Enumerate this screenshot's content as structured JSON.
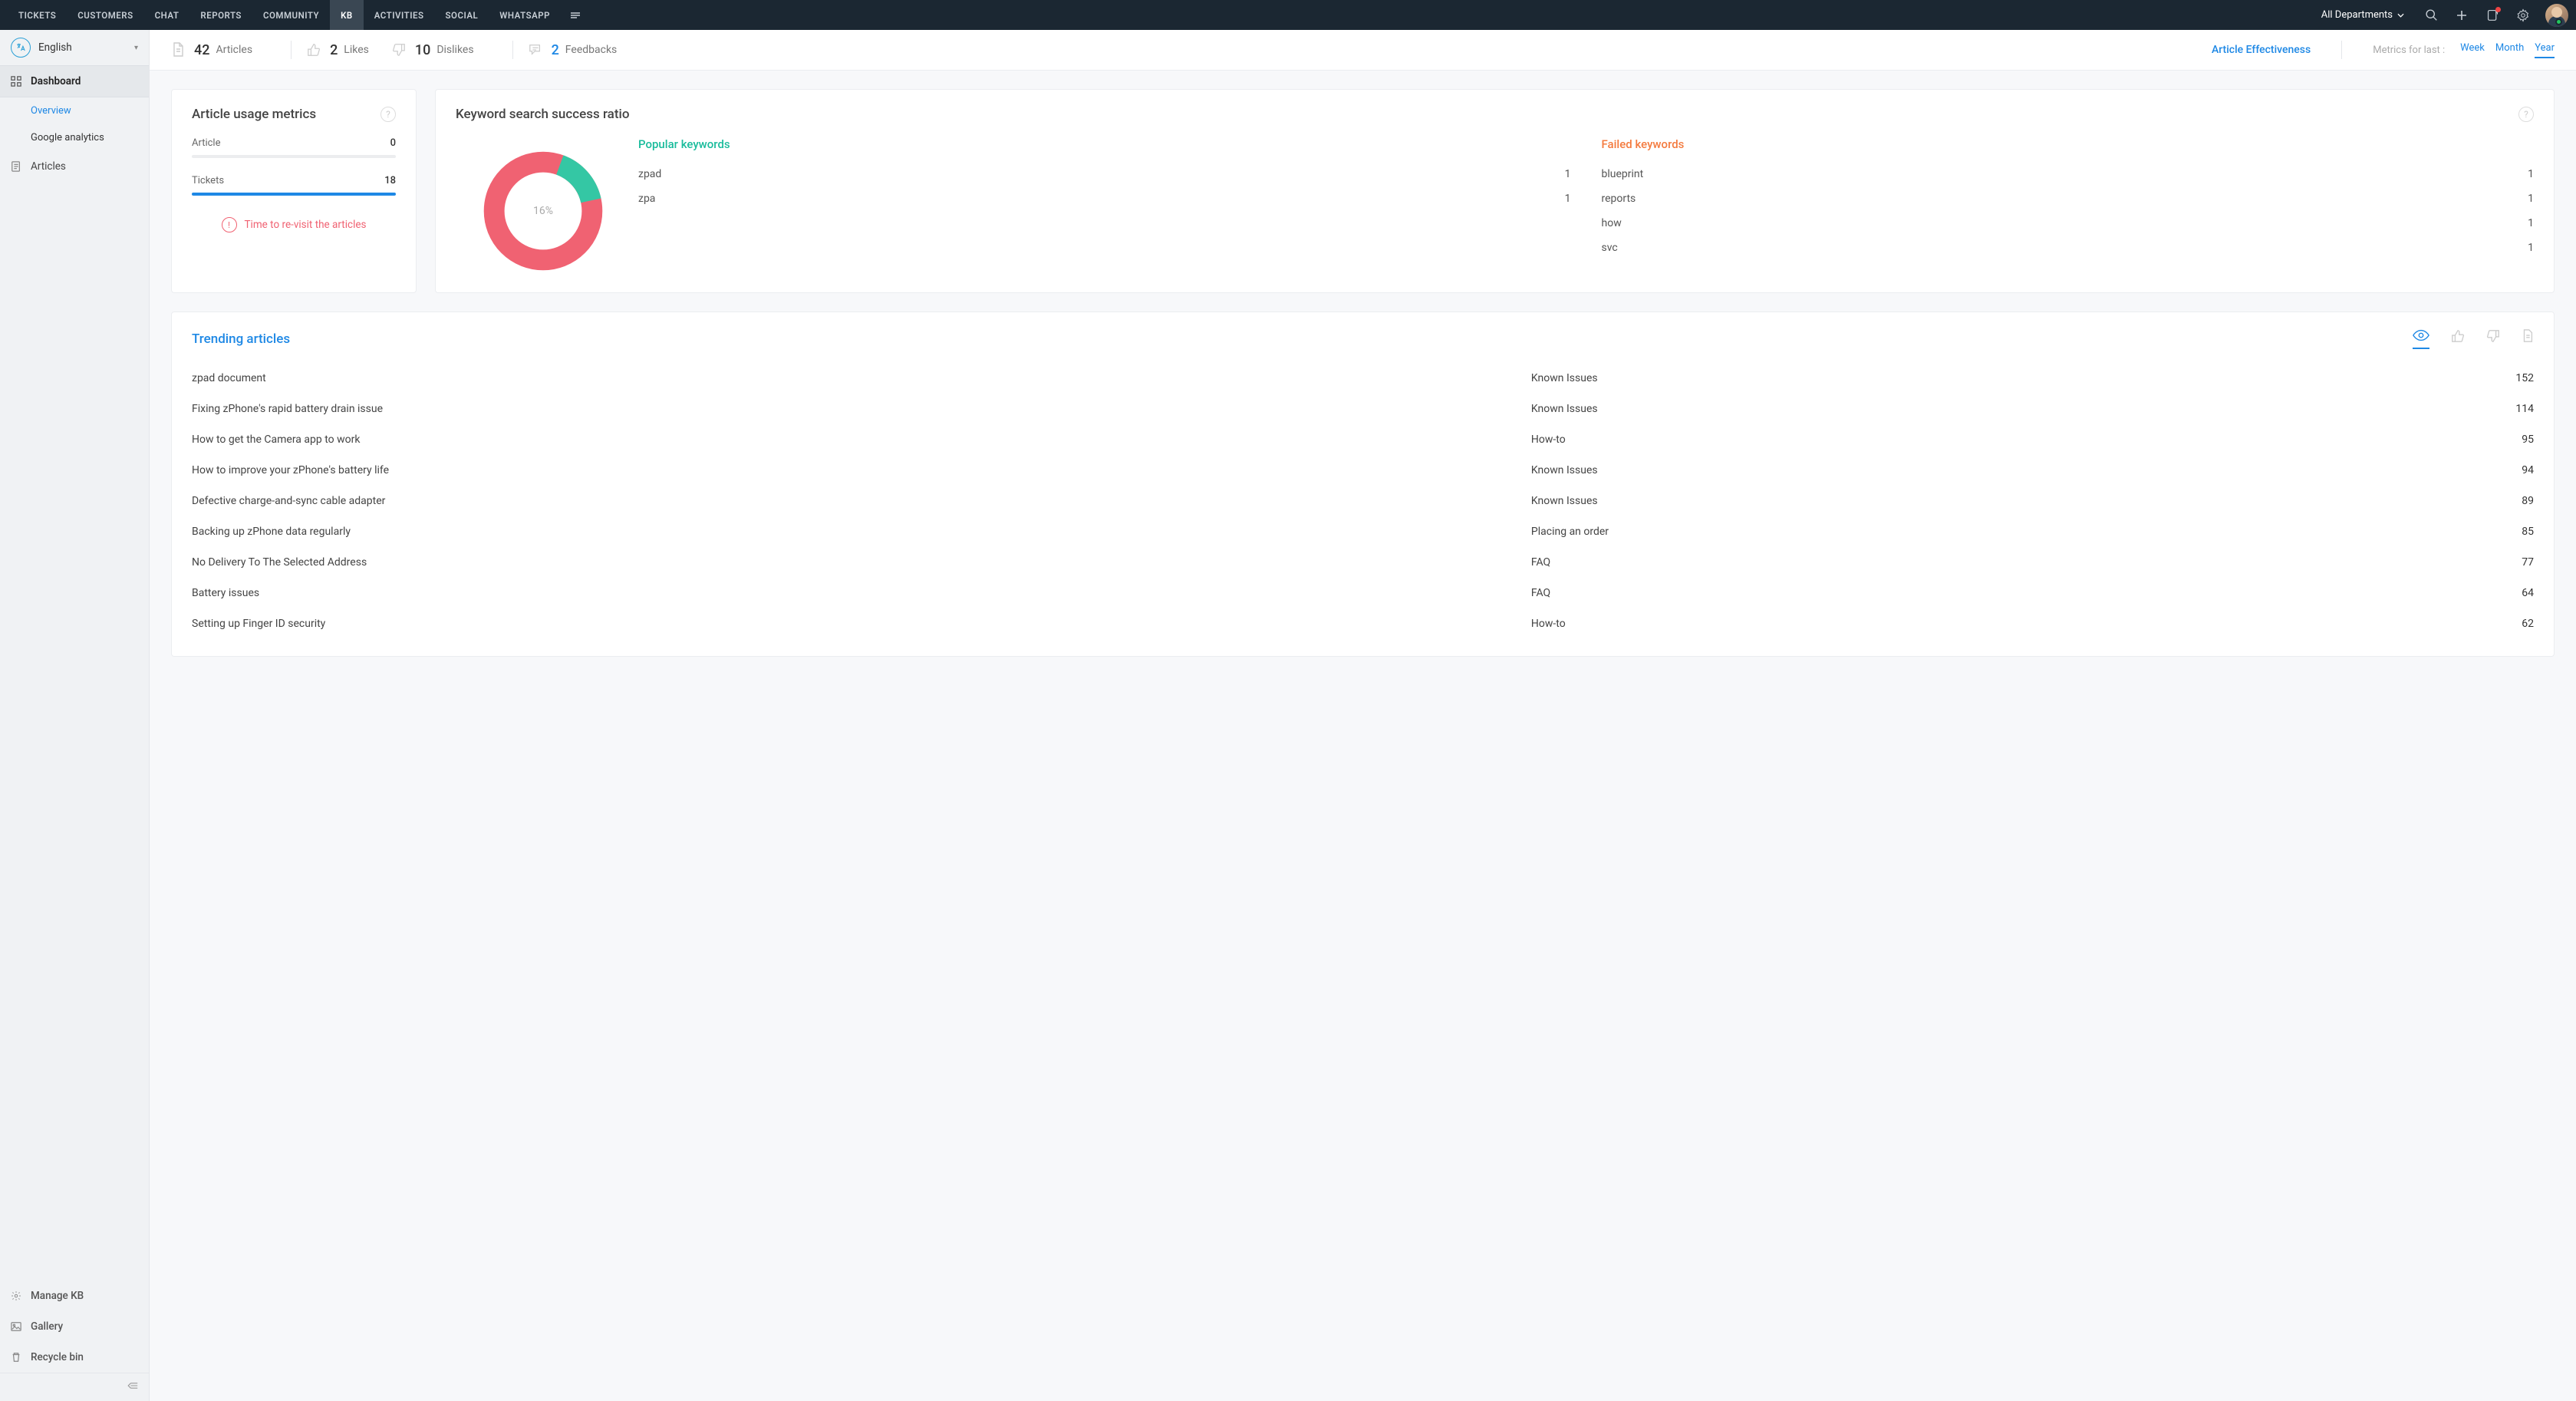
{
  "topnav": {
    "tabs": [
      "TICKETS",
      "CUSTOMERS",
      "CHAT",
      "REPORTS",
      "COMMUNITY",
      "KB",
      "ACTIVITIES",
      "SOCIAL",
      "WHATSAPP"
    ],
    "active_tab": "KB",
    "department_label": "All Departments"
  },
  "sidebar": {
    "language_label": "English",
    "dashboard_label": "Dashboard",
    "overview_label": "Overview",
    "google_analytics_label": "Google analytics",
    "articles_label": "Articles",
    "manage_kb_label": "Manage KB",
    "gallery_label": "Gallery",
    "recycle_bin_label": "Recycle bin"
  },
  "summary": {
    "articles": {
      "value": "42",
      "label": "Articles"
    },
    "likes": {
      "value": "2",
      "label": "Likes"
    },
    "dislikes": {
      "value": "10",
      "label": "Dislikes"
    },
    "feedbacks": {
      "value": "2",
      "label": "Feedbacks"
    },
    "effectiveness_link": "Article Effectiveness",
    "metrics_label": "Metrics for last :",
    "ranges": {
      "week": "Week",
      "month": "Month",
      "year": "Year"
    }
  },
  "usage": {
    "title": "Article usage metrics",
    "article_label": "Article",
    "article_value": "0",
    "tickets_label": "Tickets",
    "tickets_value": "18",
    "revisit_msg": "Time to re-visit the articles"
  },
  "keyword": {
    "title": "Keyword search success ratio",
    "ratio_pct": "16%",
    "popular_title": "Popular keywords",
    "failed_title": "Failed keywords",
    "popular": [
      {
        "word": "zpad",
        "count": "1"
      },
      {
        "word": "zpa",
        "count": "1"
      }
    ],
    "failed": [
      {
        "word": "blueprint",
        "count": "1"
      },
      {
        "word": "reports",
        "count": "1"
      },
      {
        "word": "how",
        "count": "1"
      },
      {
        "word": "svc",
        "count": "1"
      }
    ]
  },
  "trending": {
    "title": "Trending articles",
    "rows": [
      {
        "title": "zpad document",
        "category": "Known Issues",
        "count": "152"
      },
      {
        "title": "Fixing zPhone's rapid battery drain issue",
        "category": "Known Issues",
        "count": "114"
      },
      {
        "title": "How to get the Camera app to work",
        "category": "How-to",
        "count": "95"
      },
      {
        "title": "How to improve your zPhone's battery life",
        "category": "Known Issues",
        "count": "94"
      },
      {
        "title": "Defective charge-and-sync cable adapter",
        "category": "Known Issues",
        "count": "89"
      },
      {
        "title": "Backing up zPhone data regularly",
        "category": "Placing an order",
        "count": "85"
      },
      {
        "title": "No Delivery To The Selected Address",
        "category": "FAQ",
        "count": "77"
      },
      {
        "title": "Battery issues",
        "category": "FAQ",
        "count": "64"
      },
      {
        "title": "Setting up Finger ID security",
        "category": "How-to",
        "count": "62"
      }
    ]
  },
  "chart_data": {
    "type": "pie",
    "title": "Keyword search success ratio",
    "series": [
      {
        "name": "Success",
        "value": 16,
        "color": "#34c7a4"
      },
      {
        "name": "Failed",
        "value": 84,
        "color": "#f06272"
      }
    ],
    "center_label": "16%"
  }
}
